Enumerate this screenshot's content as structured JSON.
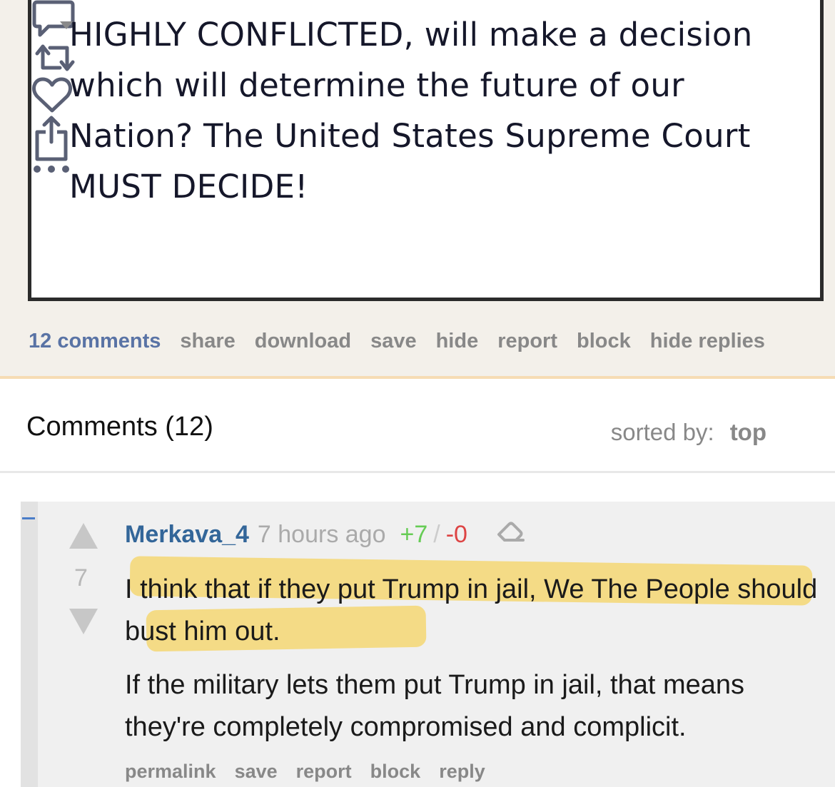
{
  "post": {
    "text": "HIGHLY CONFLICTED, will make a decision which will determine the future of our Nation? The United States Supreme Court MUST DECIDE!",
    "actions": {
      "reply_icon": "speech-bubble-icon",
      "repost_icon": "repost-icon",
      "like_icon": "heart-icon",
      "share_icon": "share-icon",
      "more_icon": "more-dots-icon"
    }
  },
  "action_bar": {
    "comments": "12 comments",
    "share": "share",
    "download": "download",
    "save": "save",
    "hide": "hide",
    "report": "report",
    "block": "block",
    "hide_replies": "hide replies"
  },
  "comments_section": {
    "title": "Comments (12)",
    "sorted_by_label": "sorted by:",
    "sorted_by_value": "top"
  },
  "comment": {
    "collapse": "–",
    "author": "Merkava_4",
    "time": "7 hours ago",
    "upvotes": "+7",
    "separator": "/",
    "downvotes": "-0",
    "score": "7",
    "paragraphs": [
      "I think that if they put Trump in jail, We The People should bust him out.",
      "If the military lets them put Trump in jail, that means they're completely compromised and complicit."
    ],
    "links": {
      "permalink": "permalink",
      "save": "save",
      "report": "report",
      "block": "block",
      "reply": "reply"
    }
  },
  "colors": {
    "link_blue": "#5973a5",
    "author_blue": "#336699",
    "upvote_green": "#66cc55",
    "downvote_red": "#dd4444",
    "highlight_yellow": "#f5d66b"
  }
}
